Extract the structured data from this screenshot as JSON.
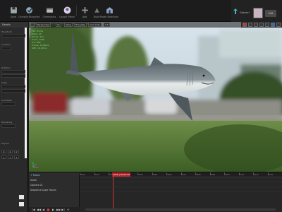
{
  "toolbar": {
    "items": [
      {
        "label": "Save",
        "icon": "save-icon"
      },
      {
        "label": "Compile Blueprint",
        "icon": "compile-icon"
      },
      {
        "label": "Cinematics",
        "icon": "cinematics-icon"
      },
      {
        "label": "Layout Panel",
        "icon": "avatar-icon"
      },
      {
        "label": "Add",
        "icon": "plus-icon"
      },
      {
        "label": "Build",
        "icon": "build-icon"
      },
      {
        "label": "Mode Selection",
        "icon": "mode-icon"
      }
    ],
    "user_name": "Gabriel",
    "profile_chip": "Edit"
  },
  "left_panel": {
    "title": "Details",
    "labels": [
      "Transform",
      "Location",
      "Rotation",
      "Scale",
      "Animation",
      "Rendering",
      "Physics"
    ],
    "numeric_values": [
      "0",
      "0",
      "0",
      "1",
      "1",
      "1"
    ]
  },
  "viewport": {
    "chips": [
      "Perspective",
      "Lit",
      "Show",
      "Translate",
      "Cam Auto",
      "0.5"
    ],
    "stats": [
      "FPS: 59.94",
      "Mesh: 23",
      "Draws: 241",
      "Prims: 128K",
      "Tris: 89K",
      "Frame: 16.68ms",
      "GPU: 12.40ms"
    ],
    "scene_description": "Great white shark model floating over blurred outdoor park with trees, cars and building",
    "colors": {
      "sky": "#c8d8e8",
      "grass": "#3f6a2a",
      "shark_top": "#6f7b82",
      "shark_belly": "#e8ecec"
    }
  },
  "timeline": {
    "tracks": [
      "+ Tracks",
      "Shark",
      "Camera 01",
      "Sequence Layer Tracks"
    ],
    "playhead_label": "0006 | 00:00:06",
    "ruler_labels": [
      "0000",
      "0010",
      "0020",
      "0030",
      "0040",
      "0050",
      "0060",
      "0070",
      "0080",
      "0090",
      "0100",
      "0110",
      "0120",
      "0130"
    ],
    "transport": [
      "|◀",
      "◀◀",
      "◀",
      "■",
      "▶",
      "▶▶",
      "▶|",
      "⟲"
    ]
  }
}
